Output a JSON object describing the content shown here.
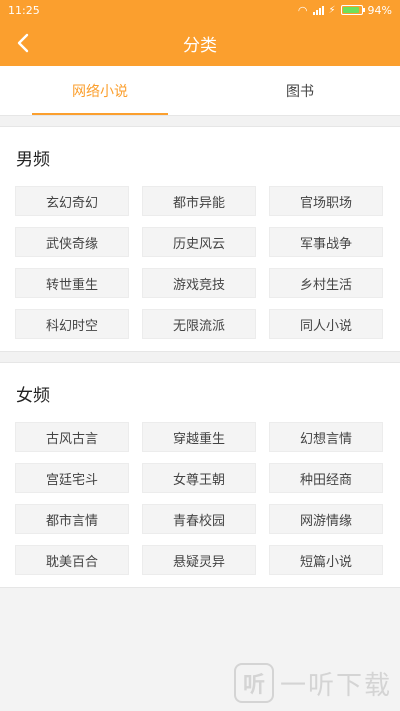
{
  "status": {
    "time": "11:25",
    "battery": "94%",
    "battery_level": 0.94
  },
  "header": {
    "title": "分类"
  },
  "tabs": [
    {
      "label": "网络小说"
    },
    {
      "label": "图书"
    }
  ],
  "sections": [
    {
      "title": "男频",
      "items": [
        "玄幻奇幻",
        "都市异能",
        "官场职场",
        "武侠奇缘",
        "历史风云",
        "军事战争",
        "转世重生",
        "游戏竞技",
        "乡村生活",
        "科幻时空",
        "无限流派",
        "同人小说"
      ]
    },
    {
      "title": "女频",
      "items": [
        "古风古言",
        "穿越重生",
        "幻想言情",
        "宫廷宅斗",
        "女尊王朝",
        "种田经商",
        "都市言情",
        "青春校园",
        "网游情缘",
        "耽美百合",
        "悬疑灵异",
        "短篇小说"
      ]
    }
  ],
  "watermark": {
    "text": "一听下载",
    "logo_char": "听"
  },
  "colors": {
    "accent": "#fb9f2e"
  }
}
